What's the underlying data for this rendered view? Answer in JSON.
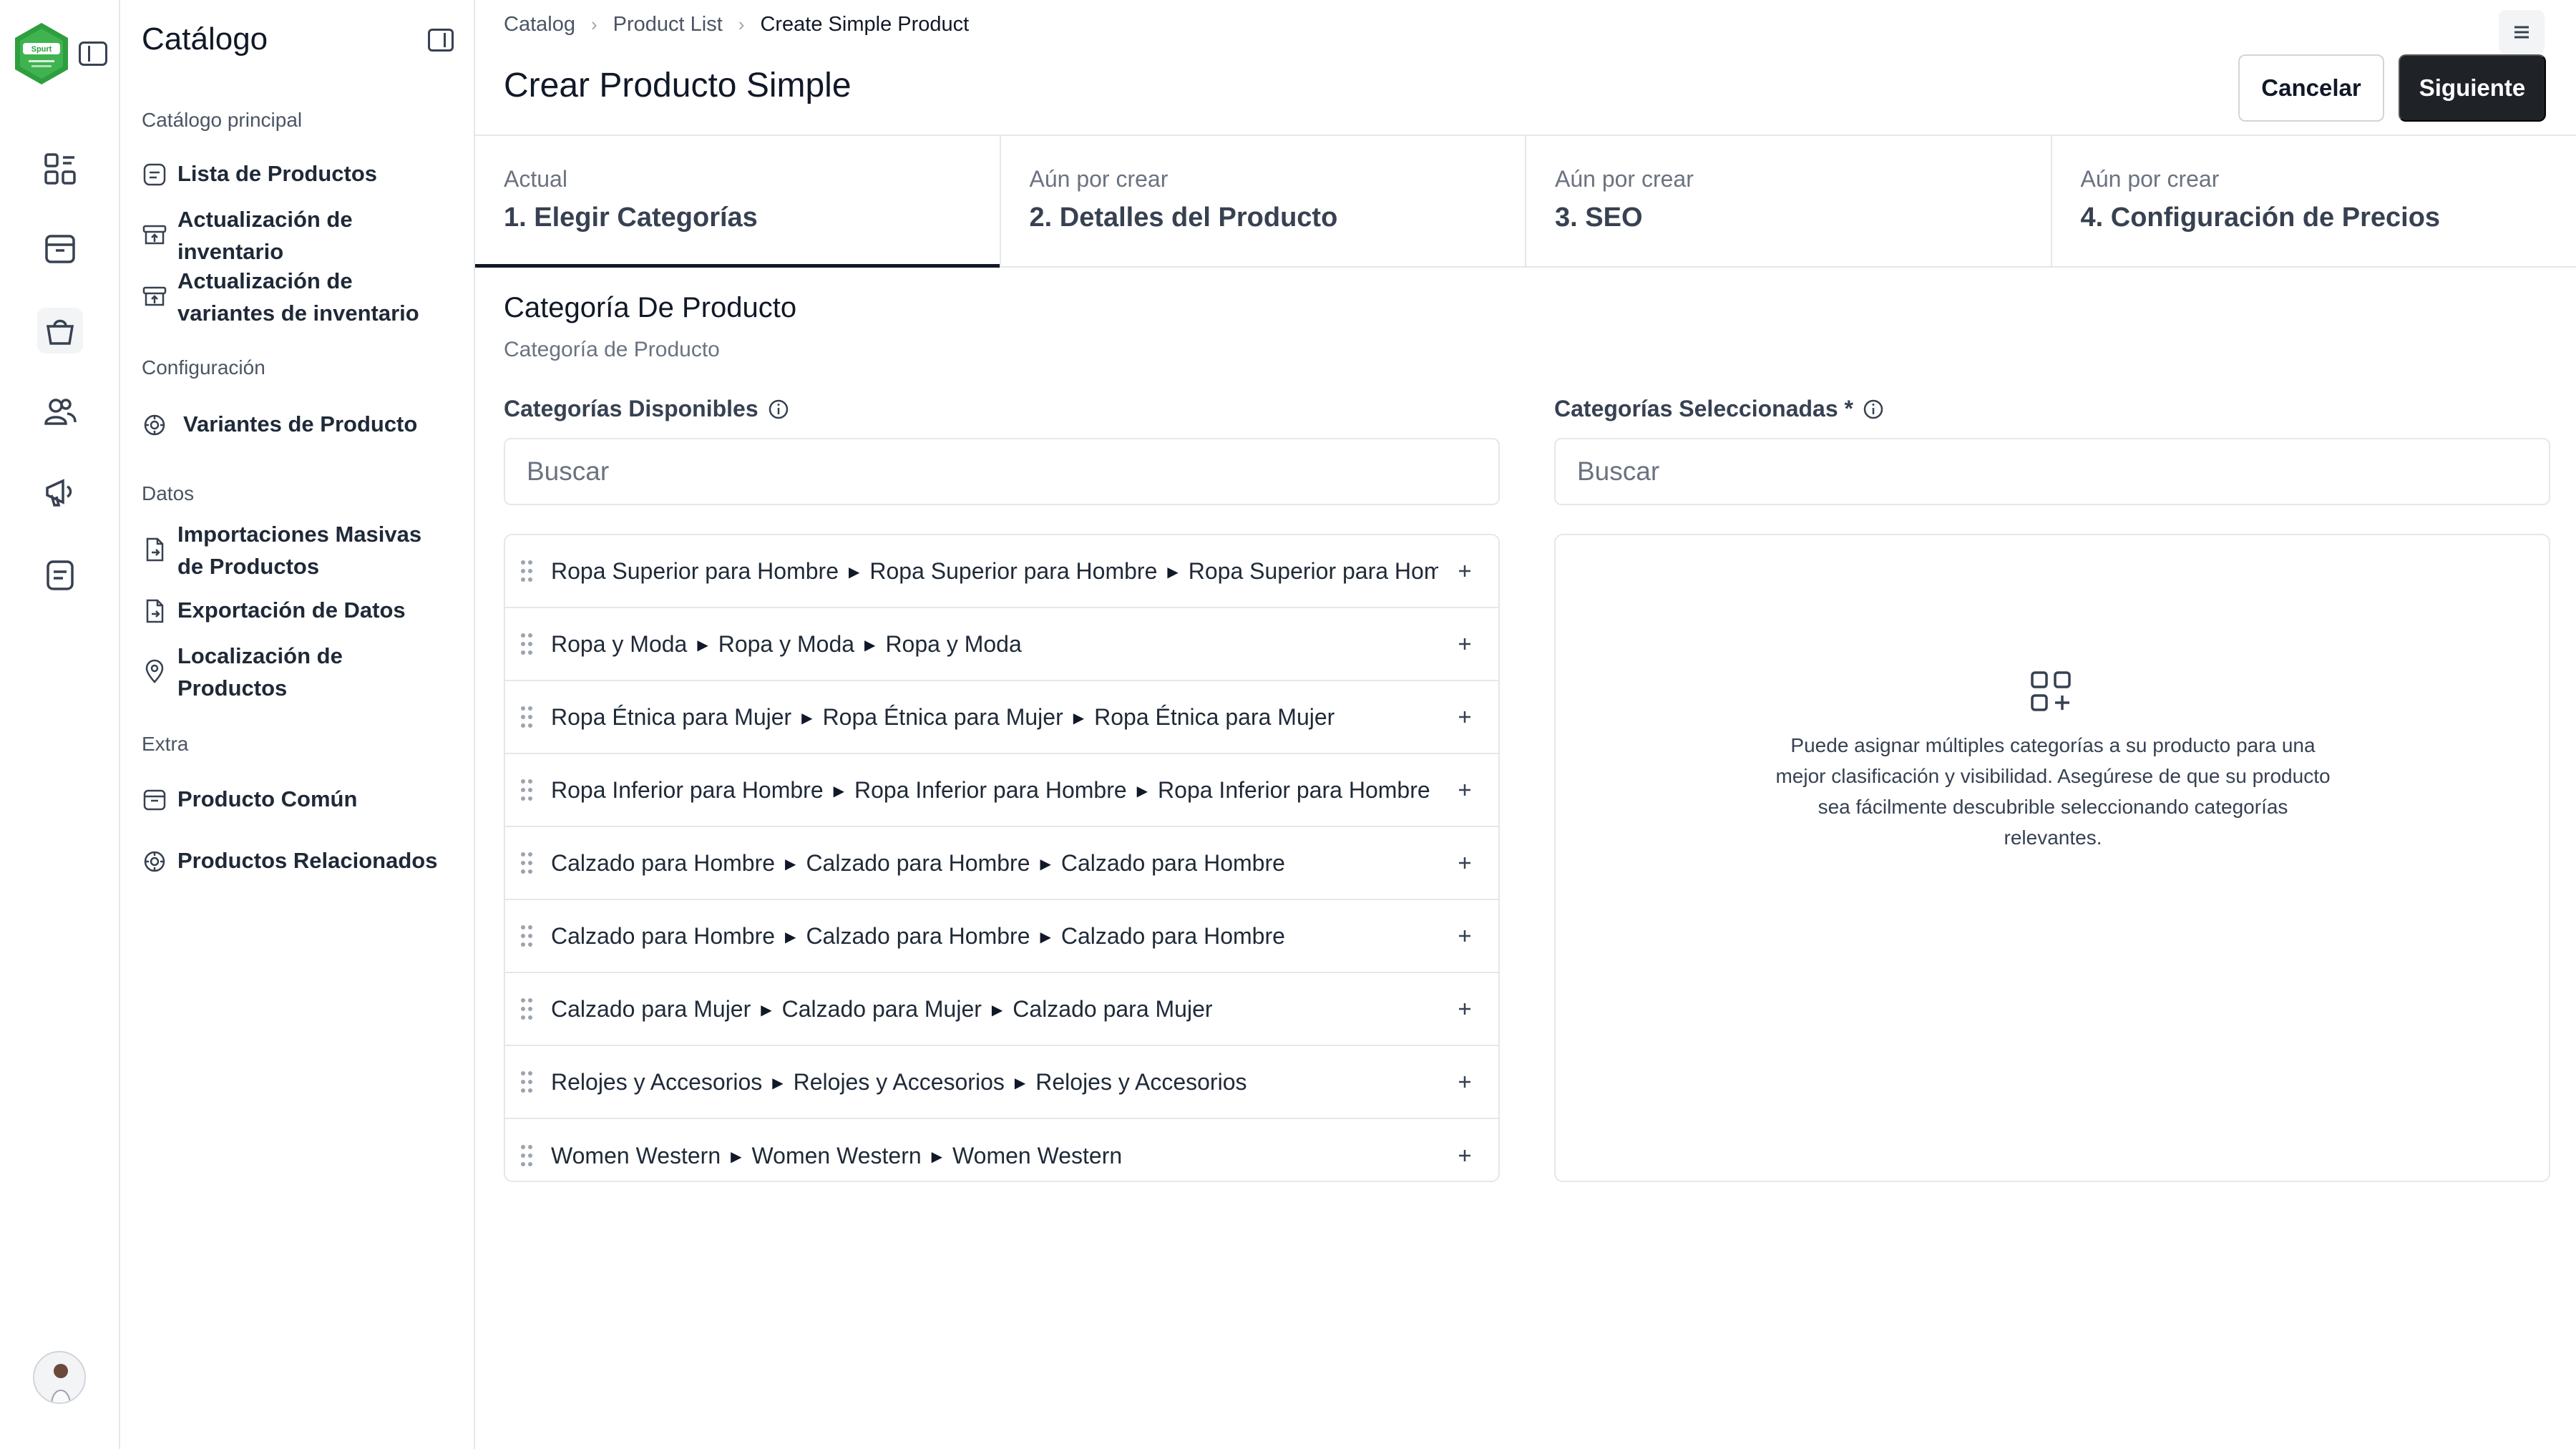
{
  "brand": {
    "logo_text": "Spurt",
    "accent": "#2e9e3e"
  },
  "rail": {
    "items": [
      {
        "name": "dashboard-icon"
      },
      {
        "name": "box-icon"
      },
      {
        "name": "shopping-bag-icon",
        "active": true
      },
      {
        "name": "users-icon"
      },
      {
        "name": "megaphone-icon"
      },
      {
        "name": "document-icon"
      }
    ]
  },
  "sidebar": {
    "title": "Catálogo",
    "sections": [
      {
        "heading": "Catálogo principal"
      },
      {
        "heading": "Configuración"
      },
      {
        "heading": "Datos"
      },
      {
        "heading": "Extra"
      }
    ],
    "items": [
      {
        "label": "Lista de Productos"
      },
      {
        "label": "Actualización de inventario"
      },
      {
        "label": "Actualización de variantes de inventario"
      },
      {
        "label": "Variantes de Producto"
      },
      {
        "label": "Importaciones Masivas de Productos"
      },
      {
        "label": "Exportación de Datos"
      },
      {
        "label": "Localización de Productos"
      },
      {
        "label": "Producto Común"
      },
      {
        "label": "Productos Relacionados"
      }
    ]
  },
  "header": {
    "breadcrumb": [
      "Catalog",
      "Product List",
      "Create Simple Product"
    ],
    "title": "Crear Producto Simple",
    "cancel_label": "Cancelar",
    "next_label": "Siguiente"
  },
  "steps": [
    {
      "status": "Actual",
      "label": "1. Elegir Categorías",
      "active": true
    },
    {
      "status": "Aún por crear",
      "label": "2. Detalles del Producto"
    },
    {
      "status": "Aún por crear",
      "label": "3. SEO"
    },
    {
      "status": "Aún por crear",
      "label": "4. Configuración de Precios"
    }
  ],
  "section": {
    "title": "Categoría De Producto",
    "subtitle": "Categoría de Producto"
  },
  "available": {
    "label": "Categorías Disponibles",
    "search_placeholder": "Buscar",
    "items": [
      [
        "Ropa Superior para Hombre",
        "Ropa Superior para Hombre",
        "Ropa Superior para Hombre"
      ],
      [
        "Ropa y Moda",
        "Ropa y Moda",
        "Ropa y Moda"
      ],
      [
        "Ropa Étnica para Mujer",
        "Ropa Étnica para Mujer",
        "Ropa Étnica para Mujer"
      ],
      [
        "Ropa Inferior para Hombre",
        "Ropa Inferior para Hombre",
        "Ropa Inferior para Hombre"
      ],
      [
        "Calzado para Hombre",
        "Calzado para Hombre",
        "Calzado para Hombre"
      ],
      [
        "Calzado para Hombre",
        "Calzado para Hombre",
        "Calzado para Hombre"
      ],
      [
        "Calzado para Mujer",
        "Calzado para Mujer",
        "Calzado para Mujer"
      ],
      [
        "Relojes y Accesorios",
        "Relojes y Accesorios",
        "Relojes y Accesorios"
      ],
      [
        "Women Western",
        "Women Western",
        "Women Western"
      ]
    ]
  },
  "selected": {
    "label": "Categorías Seleccionadas *",
    "search_placeholder": "Buscar",
    "empty_text": "Puede asignar múltiples categorías a su producto para una mejor clasificación y visibilidad. Asegúrese de que su producto sea fácilmente descubrible seleccionando categorías relevantes."
  }
}
